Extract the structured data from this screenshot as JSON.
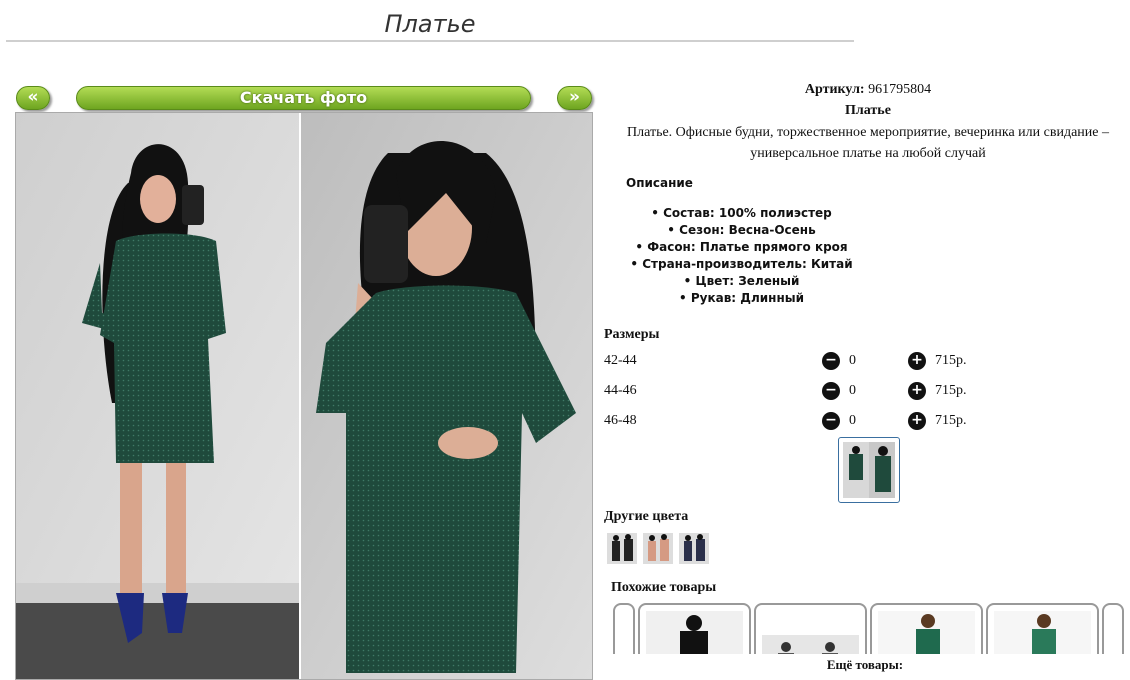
{
  "page": {
    "title": "Платье"
  },
  "gallery": {
    "prev_label": "«",
    "next_label": "»",
    "download_label": "Скачать фото"
  },
  "product": {
    "article_label": "Артикул:",
    "article_value": "961795804",
    "name": "Платье",
    "description": "Платье. Офисные будни, торжественное мероприятие, вечеринка или свидание – универсальное платье на любой случай",
    "props_heading": "Описание",
    "props": [
      "Состав: 100% полиэстер",
      "Сезон: Весна-Осень",
      "Фасон: Платье прямого кроя",
      "Страна-производитель: Китай",
      "Цвет: Зеленый",
      "Рукав: Длинный"
    ]
  },
  "sizes": {
    "heading": "Размеры",
    "rows": [
      {
        "label": "42-44",
        "qty": "0",
        "price": "715р."
      },
      {
        "label": "44-46",
        "qty": "0",
        "price": "715р."
      },
      {
        "label": "46-48",
        "qty": "0",
        "price": "715р."
      }
    ]
  },
  "other_colors": {
    "heading": "Другие цвета"
  },
  "similar": {
    "heading": "Похожие товары"
  },
  "more": {
    "title": "Ещё товары:"
  },
  "colors": {
    "accent_green": "#8cc63f",
    "dress_green": "#1f4a3c"
  }
}
